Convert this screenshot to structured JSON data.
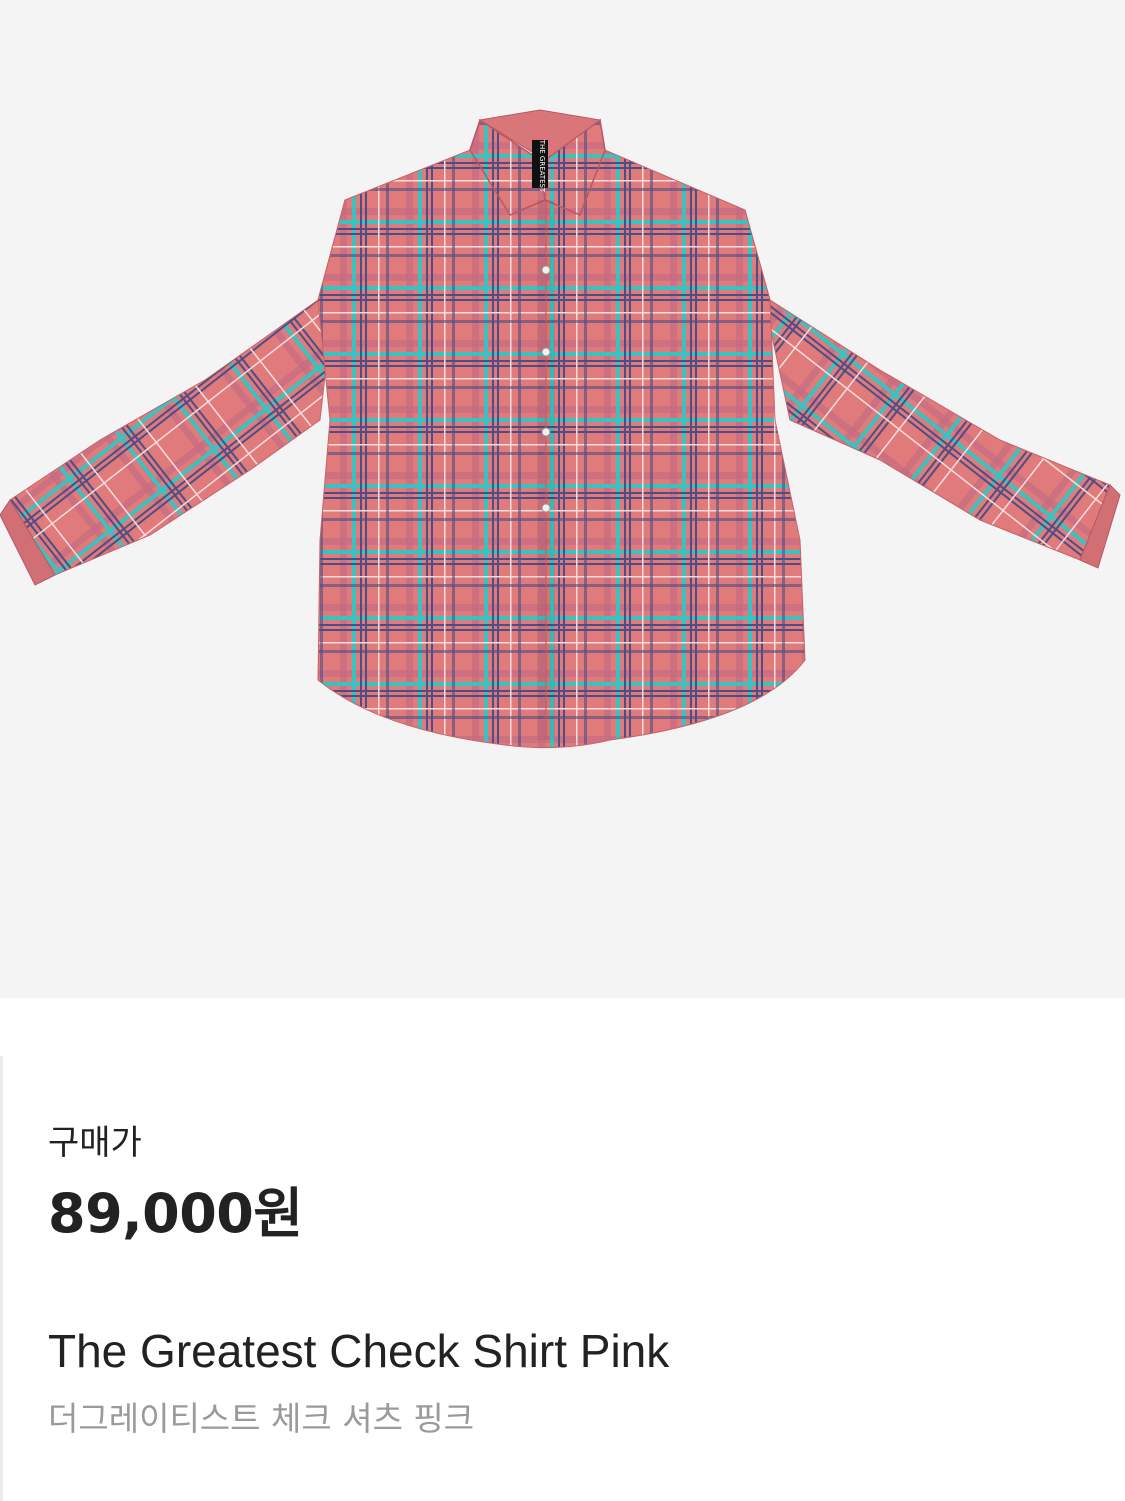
{
  "product": {
    "image_icon": "plaid-shirt-icon",
    "tag_text": "THE GREATEST",
    "colors": {
      "background": "#f4f4f5",
      "fabric_pink": "#e07a7b",
      "plaid_teal": "#39c2c0",
      "plaid_navy": "#4b4f86",
      "plaid_white": "#f6dede"
    },
    "price_label": "구매가",
    "price": "89,000원",
    "name_en": "The Greatest Check Shirt Pink",
    "name_ko": "더그레이티스트 체크 셔츠 핑크"
  }
}
